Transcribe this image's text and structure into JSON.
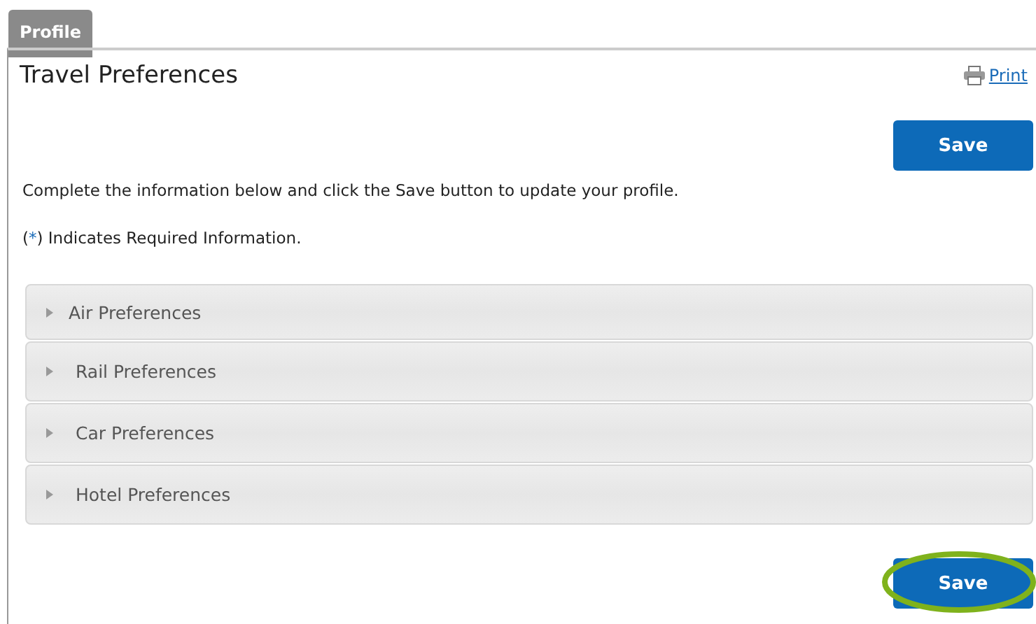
{
  "tab": {
    "label": "Profile",
    "selected": true
  },
  "title": "Travel Preferences",
  "print_link": "Print",
  "top_button": "Save",
  "instructions": "Complete the information below and click the Save button to update your profile.",
  "required_note": {
    "before": "(",
    "mark": "*",
    "after": ") Indicates Required Information."
  },
  "sections": [
    {
      "label": "Air Preferences",
      "expanded": false
    },
    {
      "label": "Rail Preferences",
      "expanded": false
    },
    {
      "label": "Car Preferences",
      "expanded": false
    },
    {
      "label": "Hotel Preferences",
      "expanded": false
    }
  ],
  "bottom_button": {
    "label": "Save",
    "highlighted": true
  }
}
